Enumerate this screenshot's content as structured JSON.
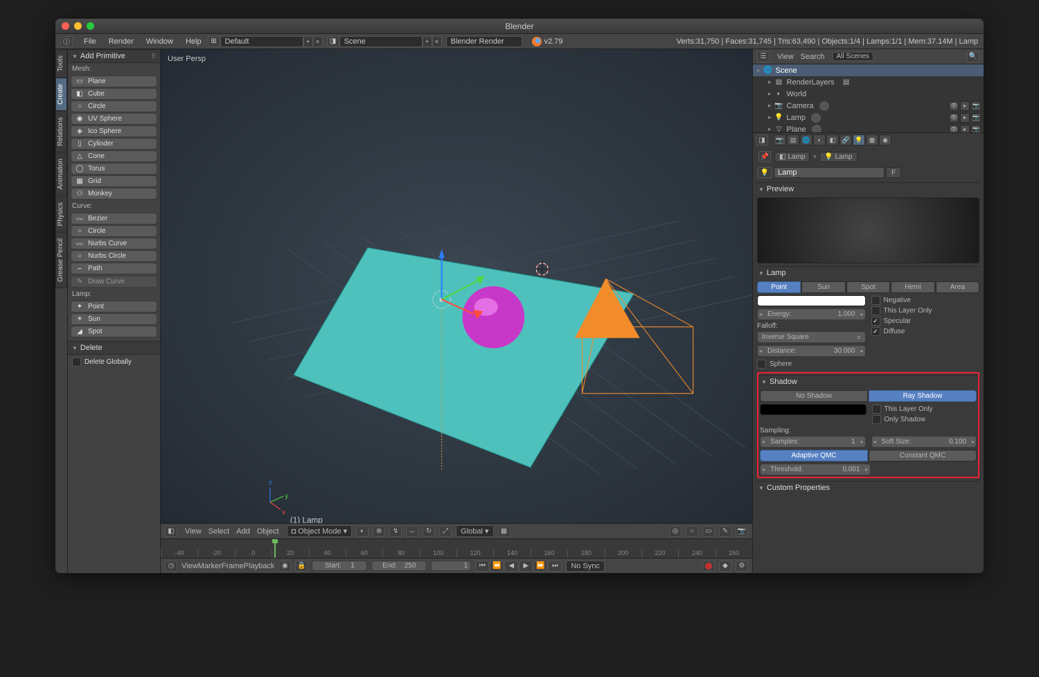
{
  "window_title": "Blender",
  "topmenu": [
    "File",
    "Render",
    "Window",
    "Help"
  ],
  "layout_name": "Default",
  "scene_name": "Scene",
  "engine": "Blender Render",
  "version": "v2.79",
  "stats": "Verts:31,750 | Faces:31,745 | Tris:63,490 | Objects:1/4 | Lamps:1/1 | Mem:37.14M | Lamp",
  "left_tabs": [
    "Tools",
    "Create",
    "Relations",
    "Animation",
    "Physics",
    "Grease Pencil"
  ],
  "left_active": "Create",
  "toolshelf": {
    "add_primitive": "Add Primitive",
    "mesh_label": "Mesh:",
    "mesh": [
      "Plane",
      "Cube",
      "Circle",
      "UV Sphere",
      "Ico Sphere",
      "Cylinder",
      "Cone",
      "Torus",
      "Grid",
      "Monkey"
    ],
    "mesh_icons": [
      "▭",
      "◧",
      "○",
      "◉",
      "◈",
      "▯",
      "△",
      "◯",
      "▦",
      "⚇"
    ],
    "curve_label": "Curve:",
    "curve": [
      "Bezier",
      "Circle",
      "Nurbs Curve",
      "Nurbs Circle",
      "Path"
    ],
    "curve_icons": [
      "〰",
      "○",
      "〰",
      "○",
      "⎯"
    ],
    "draw_curve": "Draw Curve",
    "lamp_label": "Lamp:",
    "lamp": [
      "Point",
      "Sun",
      "Spot"
    ],
    "lamp_icons": [
      "✦",
      "☀",
      "◢"
    ],
    "delete": "Delete",
    "delete_globally": "Delete Globally"
  },
  "viewport": {
    "persp": "User Persp",
    "selected": "(1) Lamp",
    "header_menus": [
      "View",
      "Select",
      "Add",
      "Object"
    ],
    "mode": "Object Mode",
    "orient": "Global"
  },
  "timeline": {
    "ticks": [
      "-40",
      "-20",
      "0",
      "20",
      "40",
      "60",
      "80",
      "100",
      "120",
      "140",
      "160",
      "180",
      "200",
      "220",
      "240",
      "260"
    ],
    "menus": [
      "View",
      "Marker",
      "Frame",
      "Playback"
    ],
    "start_lbl": "Start:",
    "start": "1",
    "end_lbl": "End:",
    "end": "250",
    "cur": "1",
    "sync": "No Sync"
  },
  "outliner": {
    "hdr_menus": [
      "View",
      "Search"
    ],
    "filter": "All Scenes",
    "rows": [
      {
        "label": "Scene",
        "icon": "🌐",
        "depth": 0
      },
      {
        "label": "RenderLayers",
        "icon": "▤",
        "depth": 1,
        "extra": true
      },
      {
        "label": "World",
        "icon": "◐",
        "depth": 1
      },
      {
        "label": "Camera",
        "icon": "📷",
        "depth": 1,
        "ctrls": true,
        "swatch": true
      },
      {
        "label": "Lamp",
        "icon": "💡",
        "depth": 1,
        "ctrls": true,
        "swatch": true
      },
      {
        "label": "Plane",
        "icon": "▽",
        "depth": 1,
        "ctrls": true,
        "swatch": true
      }
    ]
  },
  "prop": {
    "bc_obj": "Lamp",
    "bc_data": "Lamp",
    "name": "Lamp",
    "preview": "Preview",
    "lamp_hdr": "Lamp",
    "types": [
      "Point",
      "Sun",
      "Spot",
      "Hemi",
      "Area"
    ],
    "type_active": "Point",
    "energy_lbl": "Energy:",
    "energy": "1.000",
    "negative": "Negative",
    "layer_only": "This Layer Only",
    "specular": "Specular",
    "diffuse": "Diffuse",
    "falloff_lbl": "Falloff:",
    "falloff": "Inverse Square",
    "distance_lbl": "Distance:",
    "distance": "30.000",
    "sphere": "Sphere",
    "shadow_hdr": "Shadow",
    "no_shadow": "No Shadow",
    "ray_shadow": "Ray Shadow",
    "sh_layer": "This Layer Only",
    "sh_only": "Only Shadow",
    "sampling_lbl": "Sampling:",
    "samples_lbl": "Samples:",
    "samples": "1",
    "soft_lbl": "Soft Size:",
    "soft": "0.100",
    "aq": "Adaptive QMC",
    "cq": "Constant QMC",
    "thresh_lbl": "Threshold:",
    "thresh": "0.001",
    "custom": "Custom Properties"
  }
}
